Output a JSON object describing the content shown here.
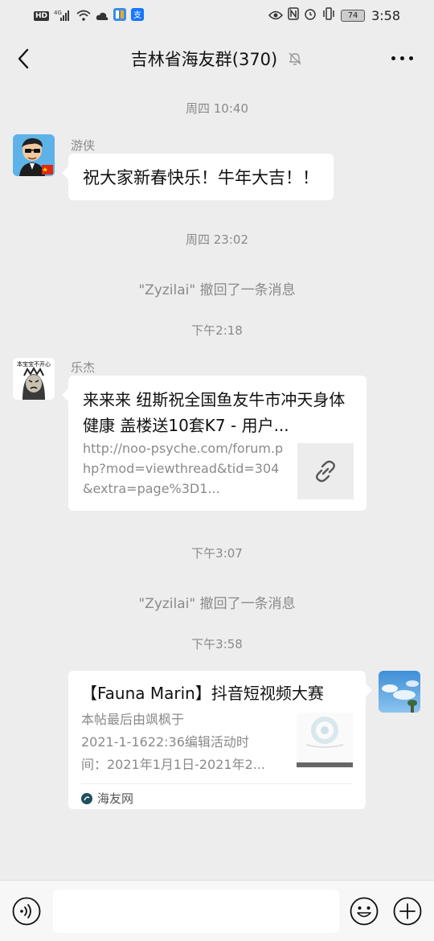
{
  "status_bar": {
    "left_badge": "HD",
    "network": "4G",
    "battery": "74",
    "time": "3:58"
  },
  "header": {
    "title": "吉林省海友群(370)"
  },
  "chat": {
    "time1": "周四 10:40",
    "msg1": {
      "sender": "游侠",
      "text": "祝大家新春快乐！牛年大吉！！"
    },
    "time2": "周四 23:02",
    "recall1": "\"Zyzilai\" 撤回了一条消息",
    "time3": "下午2:18",
    "msg2": {
      "sender": "乐杰",
      "avatar_caption": "本宝宝不开心",
      "link_title": "来来来 纽斯祝全国鱼友牛市冲天身体健康 盖楼送10套K7 - 用户...",
      "link_url": "http://noo-psyche.com/forum.php?mod=viewthread&tid=304&extra=page%3D1..."
    },
    "time4": "下午3:07",
    "recall2": "\"Zyzilai\" 撤回了一条消息",
    "time5": "下午3:58",
    "msg3": {
      "card_title": "【Fauna Marin】抖音短视频大赛",
      "desc_line1": "本帖最后由飒枫于",
      "desc_line2": "2021-1-1622:36编辑活动时",
      "desc_line3": "间：2021年1月1日-2021年2...",
      "source": "海友网"
    }
  },
  "input_bar": {
    "placeholder": ""
  },
  "colors": {
    "background": "#ededed",
    "bubble": "#ffffff",
    "meta_text": "#8a8a8a"
  }
}
